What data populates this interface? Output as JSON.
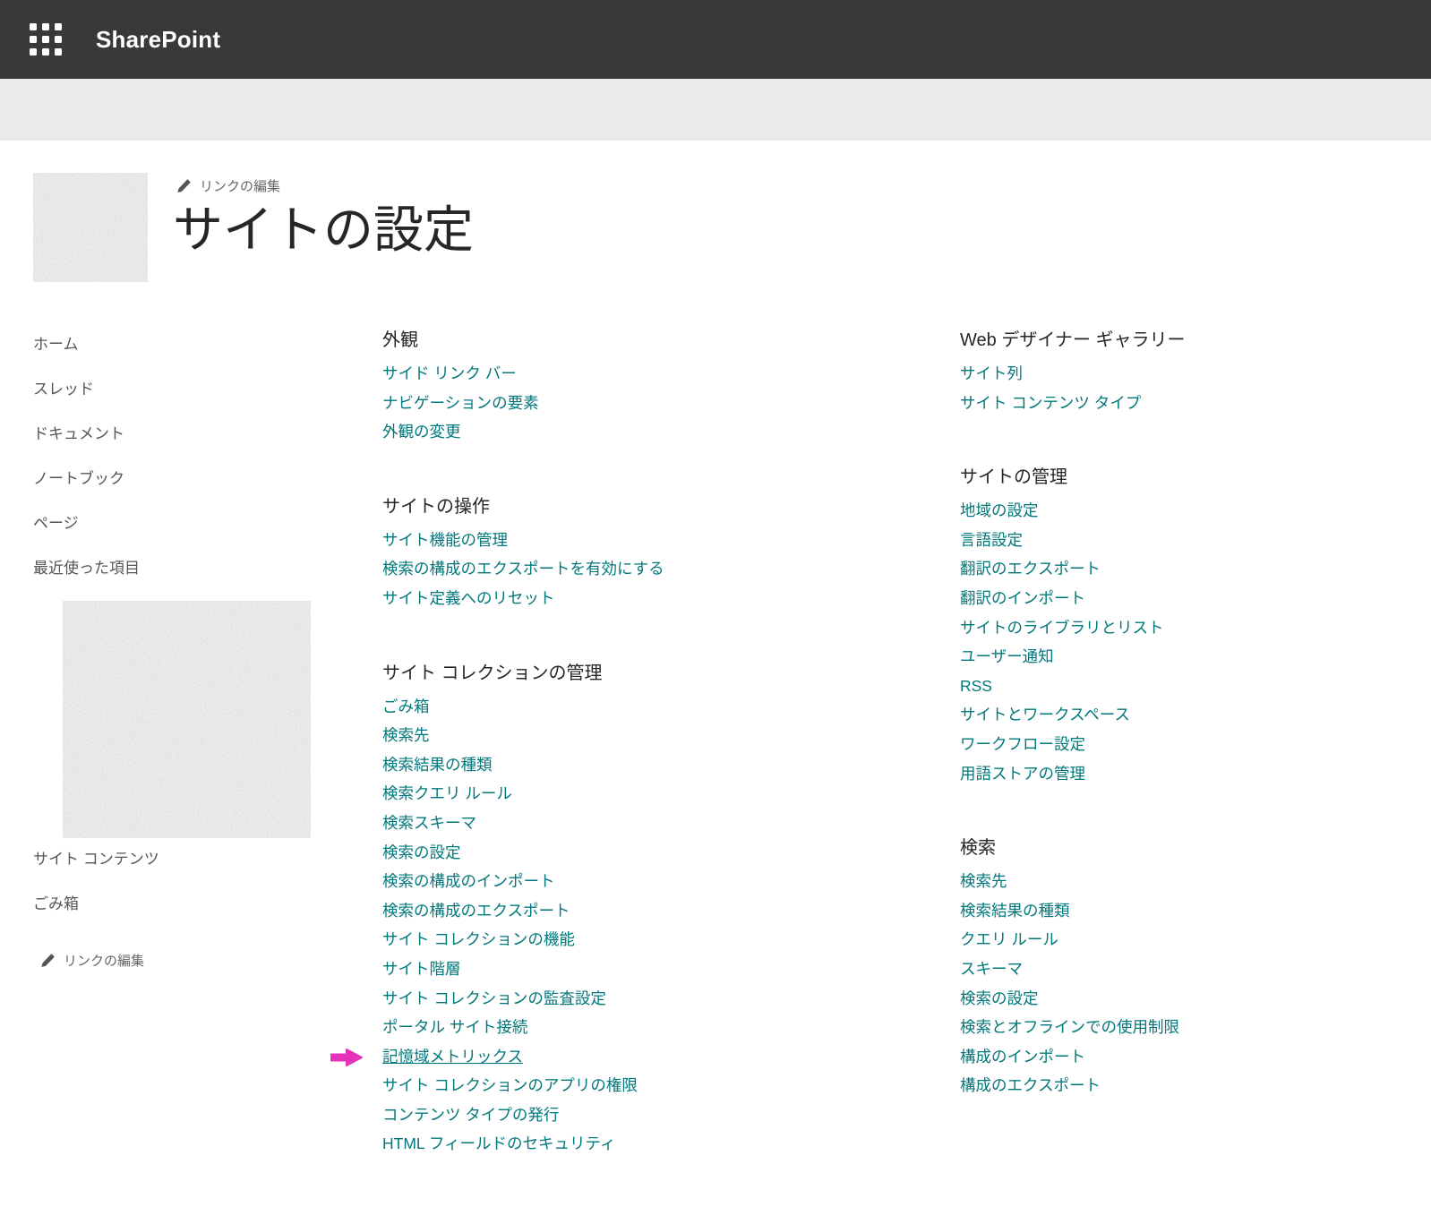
{
  "suite_bar": {
    "app_name": "SharePoint"
  },
  "header": {
    "edit_links_label": "リンクの編集",
    "page_title": "サイトの設定"
  },
  "sidebar": {
    "items_top": [
      "ホーム",
      "スレッド",
      "ドキュメント",
      "ノートブック",
      "ページ",
      "最近使った項目"
    ],
    "items_bottom": [
      "サイト コンテンツ",
      "ごみ箱"
    ],
    "edit_links_label": "リンクの編集"
  },
  "columns": {
    "middle": [
      {
        "heading": "外観",
        "links": [
          "サイド リンク バー",
          "ナビゲーションの要素",
          "外観の変更"
        ]
      },
      {
        "heading": "サイトの操作",
        "links": [
          "サイト機能の管理",
          "検索の構成のエクスポートを有効にする",
          "サイト定義へのリセット"
        ]
      },
      {
        "heading": "サイト コレクションの管理",
        "links": [
          "ごみ箱",
          "検索先",
          "検索結果の種類",
          "検索クエリ ルール",
          "検索スキーマ",
          "検索の設定",
          "検索の構成のインポート",
          "検索の構成のエクスポート",
          "サイト コレクションの機能",
          "サイト階層",
          "サイト コレクションの監査設定",
          "ポータル サイト接続",
          "記憶域メトリックス",
          "サイト コレクションのアプリの権限",
          "コンテンツ タイプの発行",
          "HTML フィールドのセキュリティ"
        ]
      }
    ],
    "right": [
      {
        "heading": "Web デザイナー ギャラリー",
        "links": [
          "サイト列",
          "サイト コンテンツ タイプ"
        ]
      },
      {
        "heading": "サイトの管理",
        "links": [
          "地域の設定",
          "言語設定",
          "翻訳のエクスポート",
          "翻訳のインポート",
          "サイトのライブラリとリスト",
          "ユーザー通知",
          "RSS",
          "サイトとワークスペース",
          "ワークフロー設定",
          "用語ストアの管理"
        ]
      },
      {
        "heading": "検索",
        "links": [
          "検索先",
          "検索結果の種類",
          "クエリ ルール",
          "スキーマ",
          "検索の設定",
          "検索とオフラインでの使用制限",
          "構成のインポート",
          "構成のエクスポート"
        ]
      }
    ]
  },
  "annotation": {
    "highlighted_link": "記憶域メトリックス"
  },
  "icons": {
    "app_launcher_icon": "waffle-grid",
    "pencil_icon": "pencil",
    "highlight_arrow_icon": "right-arrow"
  },
  "colors": {
    "suite_bar_bg": "#393937",
    "band_bg": "#eaeaea",
    "link": "#03787c",
    "heading": "#262626",
    "nav_text": "#555555",
    "muted_text": "#666666",
    "arrow": "#e632b8"
  }
}
